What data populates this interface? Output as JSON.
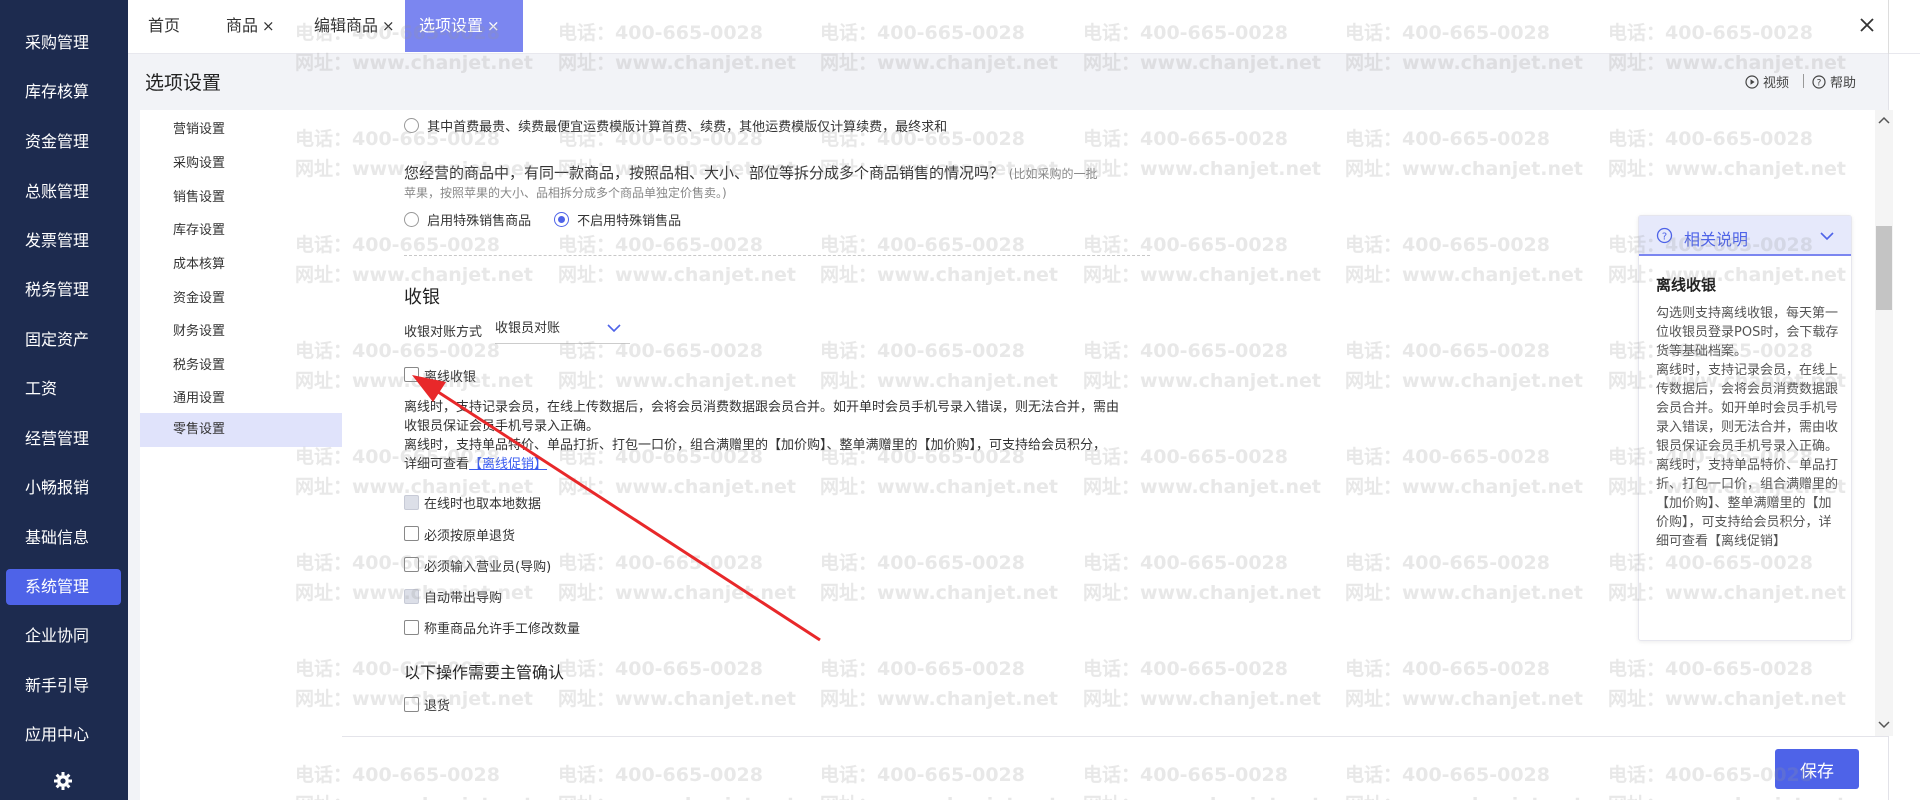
{
  "nav": {
    "items": [
      {
        "label": "采购管理"
      },
      {
        "label": "库存核算"
      },
      {
        "label": "资金管理"
      },
      {
        "label": "总账管理"
      },
      {
        "label": "发票管理"
      },
      {
        "label": "税务管理"
      },
      {
        "label": "固定资产"
      },
      {
        "label": "工资"
      },
      {
        "label": "经营管理"
      },
      {
        "label": "小畅报销"
      },
      {
        "label": "基础信息"
      },
      {
        "label": "系统管理",
        "active": true
      },
      {
        "label": "企业协同"
      },
      {
        "label": "新手引导"
      },
      {
        "label": "应用中心"
      }
    ],
    "settings_icon": "gear-icon"
  },
  "tabs": [
    {
      "label": "首页",
      "closable": false
    },
    {
      "label": "商品",
      "closable": true
    },
    {
      "label": "编辑商品",
      "closable": true
    },
    {
      "label": "选项设置",
      "closable": true,
      "active": true
    }
  ],
  "tab_close_glyph": "×",
  "header": {
    "title": "选项设置",
    "video_label": "视频",
    "help_label": "帮助"
  },
  "subnav": {
    "items": [
      {
        "label": "营销设置"
      },
      {
        "label": "采购设置"
      },
      {
        "label": "销售设置"
      },
      {
        "label": "库存设置"
      },
      {
        "label": "成本核算"
      },
      {
        "label": "资金设置"
      },
      {
        "label": "财务设置"
      },
      {
        "label": "税务设置"
      },
      {
        "label": "通用设置"
      },
      {
        "label": "零售设置",
        "active": true
      }
    ]
  },
  "content": {
    "freight_option": "其中首费最贵、续费最便宜运费模版计算首费、续费，其他运费模版仅计算续费，最终求和",
    "split_question": "您经营的商品中，有同一款商品，按照品相、大小、部位等拆分成多个商品销售的情况吗？",
    "split_hint_1": "(比如采购的一批",
    "split_hint_2": "苹果，按照苹果的大小、品相拆分成多个商品单独定价售卖。)",
    "split_options": [
      {
        "label": "启用特殊销售商品",
        "selected": false
      },
      {
        "label": "不启用特殊销售品",
        "selected": true
      }
    ],
    "cashier_section": "收银",
    "reconcile_label": "收银对账方式",
    "reconcile_value": "收银员对账",
    "offline_label": "离线收银",
    "offline_desc_1": "离线时，支持记录会员，在线上传数据后，会将会员消费数据跟会员合并。如开单时会员手机号录入错误，则无法合并，需由",
    "offline_desc_2": "收银员保证会员手机号录入正确。",
    "offline_desc_3": "离线时，支持单品特价、单品打折、打包一口价，组合满赠里的【加价购】、整单满赠里的【加价购】，可支持给会员积分，",
    "offline_desc_4_prefix": "详细可查看",
    "offline_desc_4_link": "【离线促销】",
    "checkboxes": [
      {
        "label": "在线时也取本地数据",
        "disabled": true
      },
      {
        "label": "必须按原单退货",
        "disabled": false
      },
      {
        "label": "必须输入营业员(导购)",
        "disabled": false
      },
      {
        "label": "自动带出导购",
        "disabled": true
      },
      {
        "label": "称重商品允许手工修改数量",
        "disabled": false
      }
    ],
    "supervisor_section": "以下操作需要主管确认",
    "supervisor_items": [
      {
        "label": "退货"
      }
    ]
  },
  "help_panel": {
    "title": "相关说明",
    "subtitle": "离线收银",
    "body": "勾选则支持离线收银，每天第一位收银员登录POS时，会下载存货等基础档案。\n离线时，支持记录会员，在线上传数据后，会将会员消费数据跟会员合并。如开单时会员手机号录入错误，则无法合并，需由收银员保证会员手机号录入正确。\n离线时，支持单品特价、单品打折、打包一口价，组合满赠里的【加价购】、整单满赠里的【加价购】，可支持给会员积分，详细可查看【离线促销】"
  },
  "footer": {
    "save_label": "保存"
  },
  "watermark": {
    "phone": "电话：400-665-0028",
    "site": "网址：www.chanjet.net"
  },
  "colors": {
    "nav_bg": "#1d2b4f",
    "accent": "#4e63e8",
    "active_tab": "#7b86f0",
    "annotation_arrow": "#e8282a"
  }
}
